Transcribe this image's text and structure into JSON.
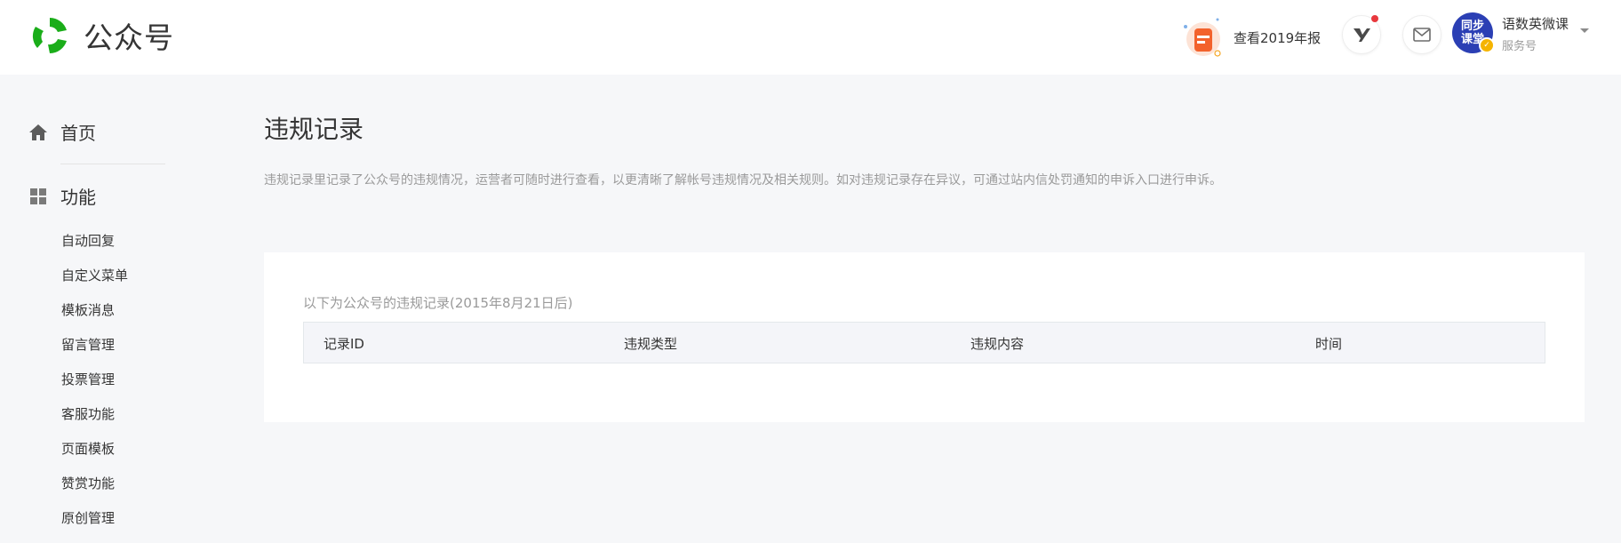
{
  "brand": {
    "name": "公众号"
  },
  "header": {
    "report_label": "查看2019年报",
    "account": {
      "avatar_text": "同步课堂",
      "name": "语数英微课",
      "type": "服务号"
    }
  },
  "sidebar": {
    "home": "首页",
    "functions": "功能",
    "items": [
      "自动回复",
      "自定义菜单",
      "模板消息",
      "留言管理",
      "投票管理",
      "客服功能",
      "页面模板",
      "赞赏功能",
      "原创管理"
    ]
  },
  "main": {
    "title": "违规记录",
    "description": "违规记录里记录了公众号的违规情况，运营者可随时进行查看，以更清晰了解帐号违规情况及相关规则。如对违规记录存在异议，可通过站内信处罚通知的申诉入口进行申诉。",
    "table": {
      "caption": "以下为公众号的违规记录(2015年8月21日后)",
      "columns": [
        "记录ID",
        "违规类型",
        "违规内容",
        "时间"
      ]
    }
  },
  "colors": {
    "brand_green": "#1aad19",
    "accent_red": "#e8383d",
    "avatar_blue": "#2b3fb4"
  }
}
